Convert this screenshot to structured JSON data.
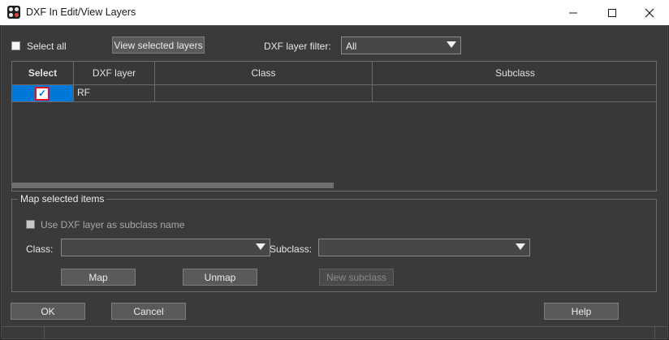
{
  "window": {
    "title": "DXF In Edit/View Layers",
    "icon": "app-icon",
    "controls": {
      "minimize": "—",
      "maximize": "☐",
      "close": "✕"
    }
  },
  "toolbar": {
    "select_all_label": "Select all",
    "select_all_checked": false,
    "view_selected_label": "View selected layers",
    "filter_label": "DXF layer filter:",
    "filter_value": "All"
  },
  "grid": {
    "columns": [
      "Select",
      "DXF layer",
      "Class",
      "Subclass"
    ],
    "rows": [
      {
        "selected": true,
        "dxf_layer": "RF",
        "class": "",
        "subclass": ""
      }
    ],
    "checkmark": "✓"
  },
  "map_group": {
    "title": "Map selected items",
    "use_subclass_label": "Use DXF layer as subclass name",
    "use_subclass_checked": false,
    "class_label": "Class:",
    "class_value": "",
    "subclass_label": "Subclass:",
    "subclass_value": "",
    "map_label": "Map",
    "unmap_label": "Unmap",
    "new_subclass_label": "New subclass"
  },
  "footer": {
    "ok_label": "OK",
    "cancel_label": "Cancel",
    "help_label": "Help"
  },
  "colors": {
    "selection": "#0078d7",
    "highlight": "#e81123",
    "background": "#3a3a3a"
  }
}
